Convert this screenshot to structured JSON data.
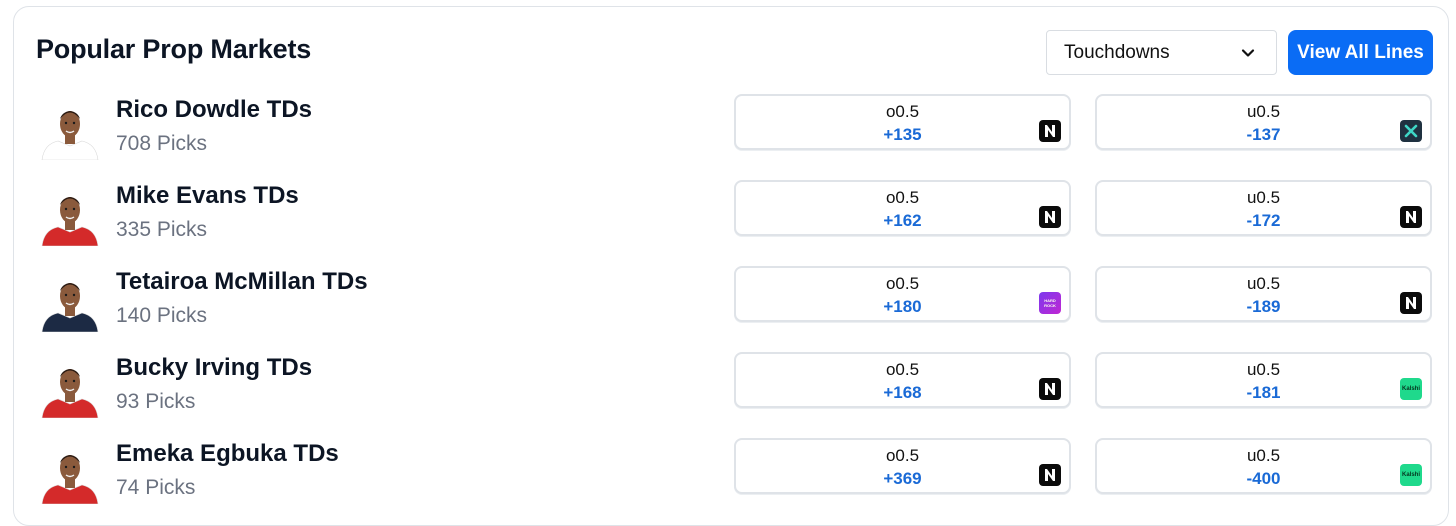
{
  "header": {
    "title": "Popular Prop Markets",
    "market_select": "Touchdowns",
    "view_all_label": "View All Lines"
  },
  "colors": {
    "accent": "#0a6cf5",
    "odds": "#1a6ad6",
    "picks_text": "#6b7280"
  },
  "props": [
    {
      "player": "Rico Dowdle TDs",
      "picks": "708 Picks",
      "jersey": "#ffffff",
      "over": {
        "line": "o0.5",
        "odds": "+135",
        "book": "novig-logo"
      },
      "under": {
        "line": "u0.5",
        "odds": "-137",
        "book": "prophet-x-logo"
      }
    },
    {
      "player": "Mike Evans TDs",
      "picks": "335 Picks",
      "jersey": "#d42a2a",
      "over": {
        "line": "o0.5",
        "odds": "+162",
        "book": "novig-logo"
      },
      "under": {
        "line": "u0.5",
        "odds": "-172",
        "book": "novig-logo"
      }
    },
    {
      "player": "Tetairoa McMillan TDs",
      "picks": "140 Picks",
      "jersey": "#1c2a44",
      "over": {
        "line": "o0.5",
        "odds": "+180",
        "book": "hard-rock-bet-logo"
      },
      "under": {
        "line": "u0.5",
        "odds": "-189",
        "book": "novig-logo"
      }
    },
    {
      "player": "Bucky Irving TDs",
      "picks": "93 Picks",
      "jersey": "#d42a2a",
      "over": {
        "line": "o0.5",
        "odds": "+168",
        "book": "novig-logo"
      },
      "under": {
        "line": "u0.5",
        "odds": "-181",
        "book": "kalshi-logo"
      }
    },
    {
      "player": "Emeka Egbuka TDs",
      "picks": "74 Picks",
      "jersey": "#d42a2a",
      "over": {
        "line": "o0.5",
        "odds": "+369",
        "book": "novig-logo"
      },
      "under": {
        "line": "u0.5",
        "odds": "-400",
        "book": "kalshi-logo"
      }
    }
  ]
}
